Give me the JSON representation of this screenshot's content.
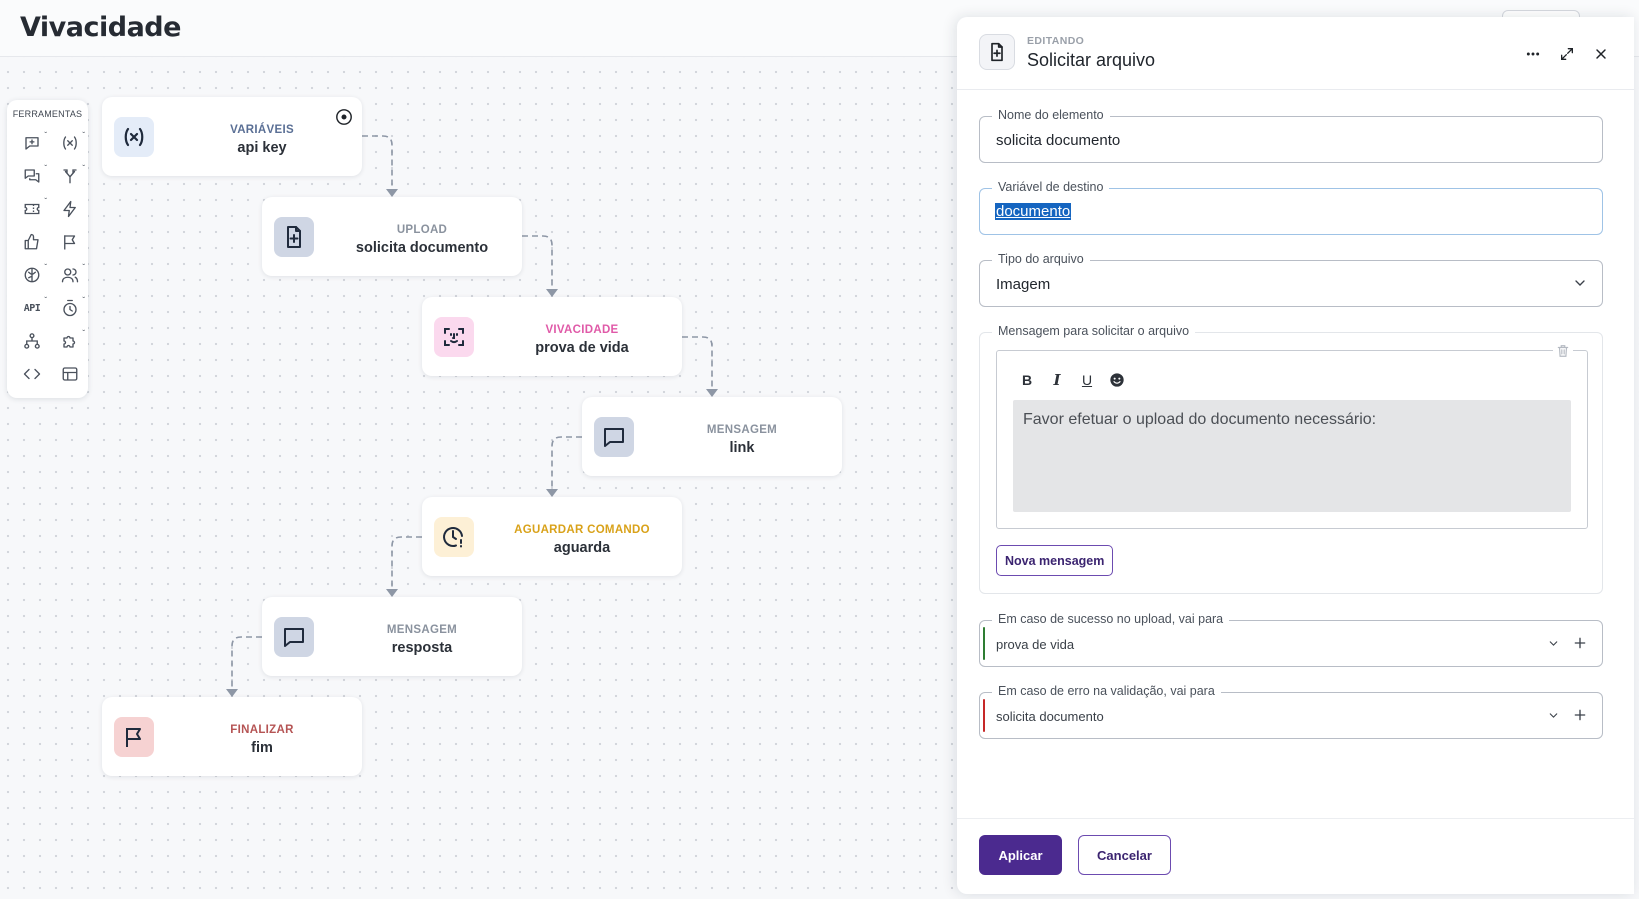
{
  "page": {
    "title": "Vivacidade"
  },
  "toolbox": {
    "title": "FERRAMENTAS",
    "api_label": "API"
  },
  "nodes": [
    {
      "kind": "VARIÁVEIS",
      "label": "api key",
      "color": "#5a6f95",
      "icon": "variable-icon"
    },
    {
      "kind": "UPLOAD",
      "label": "solicita documento",
      "color": "#8a929e",
      "icon": "file-plus-icon"
    },
    {
      "kind": "VIVACIDADE",
      "label": "prova de vida",
      "color": "#e05aa8",
      "icon": "face-scan-icon"
    },
    {
      "kind": "MENSAGEM",
      "label": "link",
      "color": "#8a929e",
      "icon": "message-icon"
    },
    {
      "kind": "AGUARDAR COMANDO",
      "label": "aguarda",
      "color": "#d9a21a",
      "icon": "clock-alert-icon"
    },
    {
      "kind": "MENSAGEM",
      "label": "resposta",
      "color": "#8a929e",
      "icon": "message-icon"
    },
    {
      "kind": "FINALIZAR",
      "label": "fim",
      "color": "#b55454",
      "icon": "flag-icon"
    }
  ],
  "panel": {
    "eyebrow": "EDITANDO",
    "title": "Solicitar arquivo",
    "fields": {
      "element_name": {
        "label": "Nome do elemento",
        "value": "solicita documento"
      },
      "target_variable": {
        "label": "Variável de destino",
        "value": "documento"
      },
      "file_type": {
        "label": "Tipo do arquivo",
        "value": "Imagem"
      }
    },
    "message": {
      "legend": "Mensagem para solicitar o arquivo",
      "format": {
        "bold": "B",
        "italic": "I",
        "underline": "U"
      },
      "text": "Favor efetuar o upload do documento necessário:",
      "add_button": "Nova mensagem"
    },
    "routes": {
      "success": {
        "label": "Em caso de sucesso no upload, vai para",
        "value": "prova de vida",
        "color": "#2e7d32"
      },
      "error": {
        "label": "Em caso de erro na validação, vai para",
        "value": "solicita documento",
        "color": "#c62828"
      }
    },
    "actions": {
      "apply": "Aplicar",
      "cancel": "Cancelar"
    }
  }
}
